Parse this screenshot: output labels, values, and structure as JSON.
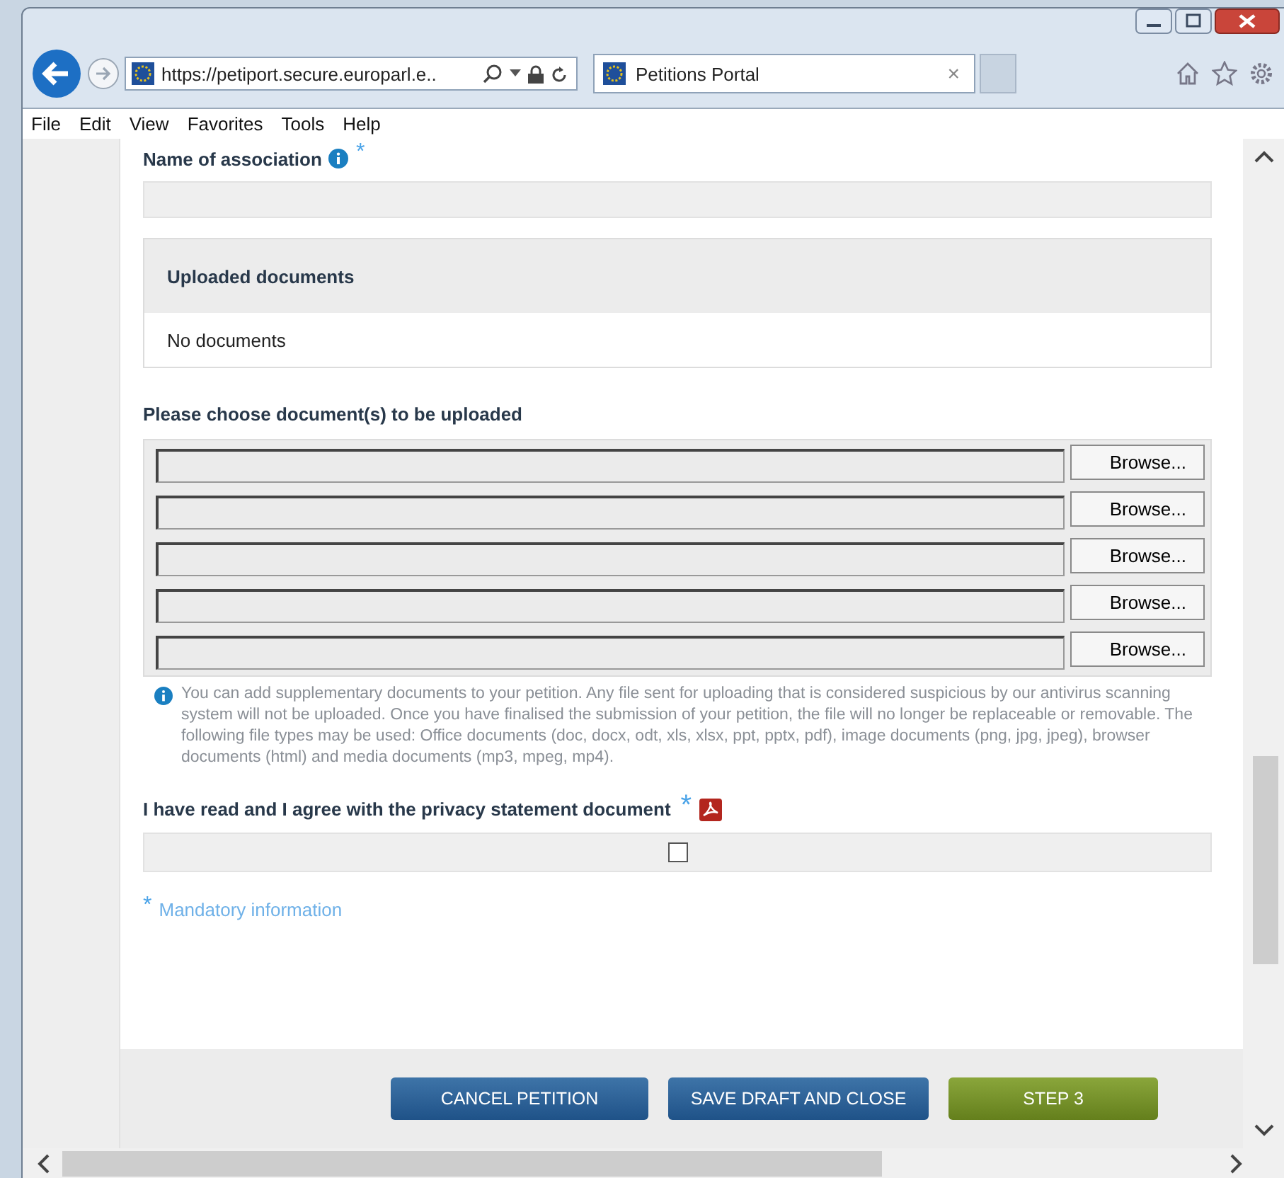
{
  "browser": {
    "address": "https://petiport.secure.europarl.e..",
    "tab_title": "Petitions Portal",
    "tab_close": "×"
  },
  "menu": [
    "File",
    "Edit",
    "View",
    "Favorites",
    "Tools",
    "Help"
  ],
  "form": {
    "association_label": "Name of association",
    "required_mark": "*",
    "uploaded": {
      "title": "Uploaded documents",
      "empty": "No documents"
    },
    "choose_label": "Please choose document(s) to be uploaded",
    "files": [
      {
        "button": "Browse..."
      },
      {
        "button": "Browse..."
      },
      {
        "button": "Browse..."
      },
      {
        "button": "Browse..."
      },
      {
        "button": "Browse..."
      }
    ],
    "info": "You can add supplementary documents to your petition. Any file sent for uploading that is considered suspicious by our antivirus scanning system will not be uploaded. Once you have finalised the submission of your petition, the file will no longer be replaceable or removable. The following file types may be used: Office documents (doc, docx, odt, xls, xlsx, ppt, pptx, pdf), image documents (png, jpg, jpeg), browser documents (html) and media documents (mp3, mpeg, mp4).",
    "privacy_label": "I have read and I agree with the privacy statement document",
    "privacy_required": "*",
    "privacy_checked": false,
    "mandatory_mark": "*",
    "mandatory": "Mandatory information"
  },
  "buttons": [
    {
      "label": "CANCEL PETITION",
      "kind": "secondary"
    },
    {
      "label": "SAVE DRAFT AND CLOSE",
      "kind": "secondary"
    },
    {
      "label": "STEP 3",
      "kind": "primary"
    }
  ]
}
